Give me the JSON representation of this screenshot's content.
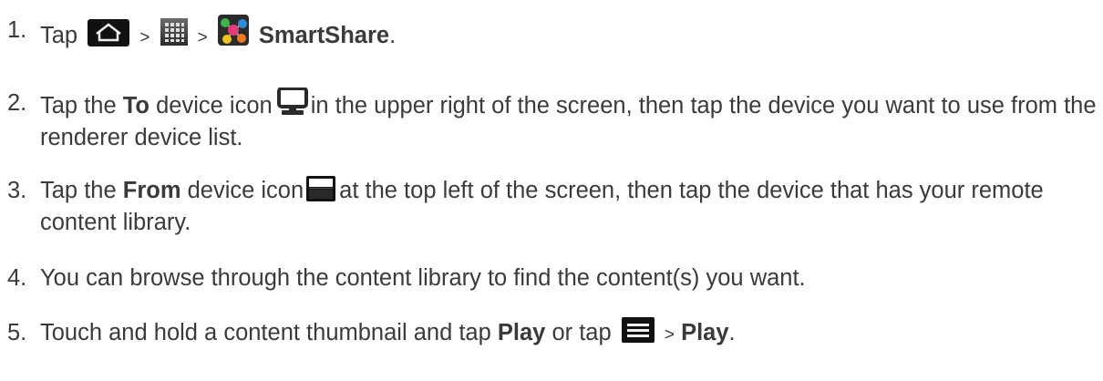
{
  "steps": [
    {
      "number": "1.",
      "parts": {
        "t1": "Tap",
        "sep1": ">",
        "sep2": ">",
        "bold": "SmartShare",
        "t2": "."
      },
      "icons": [
        "home-icon",
        "apps-grid-icon",
        "smartshare-app-icon"
      ]
    },
    {
      "number": "2.",
      "parts": {
        "t1": "Tap the",
        "bold": "To",
        "t2": "device icon",
        "t3": "in the upper right of the screen, then tap the device you want to use from the renderer device list."
      },
      "icons": [
        "monitor-device-icon"
      ]
    },
    {
      "number": "3.",
      "parts": {
        "t1": "Tap the",
        "bold": "From",
        "t2": "device icon",
        "t3": "at the top left of the screen, then tap the device that has your remote content library."
      },
      "icons": [
        "server-device-icon"
      ]
    },
    {
      "number": "4.",
      "parts": {
        "t1": "You can browse through the content library to find the content(s) you want."
      }
    },
    {
      "number": "5.",
      "parts": {
        "t1": "Touch and hold a content thumbnail and tap",
        "bold1": "Play",
        "t2": "or tap",
        "sep": ">",
        "bold2": "Play",
        "t3": "."
      },
      "icons": [
        "menu-icon"
      ]
    }
  ],
  "colors": {
    "text": "#3a3a3a",
    "icon_dark": "#111111",
    "icon_light": "#eeeeee"
  }
}
